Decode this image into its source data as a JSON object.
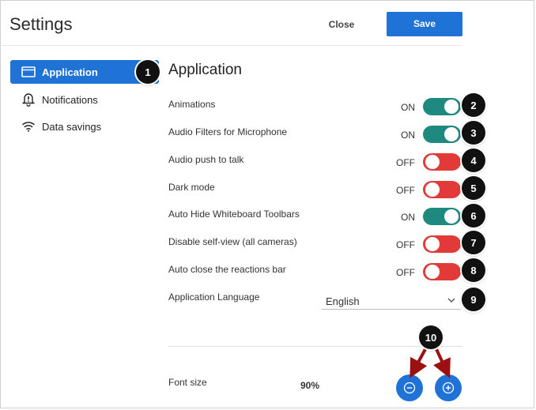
{
  "header": {
    "title": "Settings",
    "close_label": "Close",
    "save_label": "Save"
  },
  "sidebar": {
    "items": [
      {
        "label": "Application",
        "icon": "window-icon",
        "active": true
      },
      {
        "label": "Notifications",
        "icon": "alert-bell-icon",
        "active": false
      },
      {
        "label": "Data savings",
        "icon": "wifi-icon",
        "active": false
      }
    ]
  },
  "main": {
    "section_title": "Application",
    "settings": [
      {
        "label": "Animations",
        "state": "ON"
      },
      {
        "label": "Audio Filters for Microphone",
        "state": "ON"
      },
      {
        "label": "Audio push to talk",
        "state": "OFF"
      },
      {
        "label": "Dark mode",
        "state": "OFF"
      },
      {
        "label": "Auto Hide Whiteboard Toolbars",
        "state": "ON"
      },
      {
        "label": "Disable self-view (all cameras)",
        "state": "OFF"
      },
      {
        "label": "Auto close the reactions bar",
        "state": "OFF"
      }
    ],
    "language": {
      "label": "Application Language",
      "value": "English"
    },
    "font_size": {
      "label": "Font size",
      "value": "90%"
    }
  },
  "callouts": [
    "1",
    "2",
    "3",
    "4",
    "5",
    "6",
    "7",
    "8",
    "9",
    "10"
  ],
  "colors": {
    "accent": "#1f73d6",
    "toggle_on": "#1e8a7f",
    "toggle_off": "#e23a38",
    "arrow": "#9b1111"
  }
}
